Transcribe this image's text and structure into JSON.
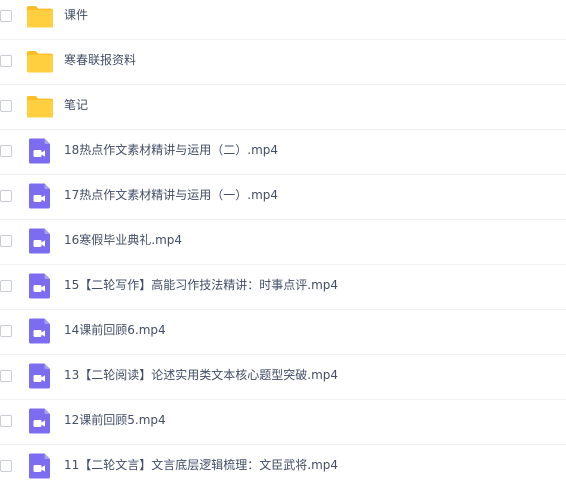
{
  "file_list": {
    "colors": {
      "folder": "#ffcf3f",
      "folder_tab": "#ffbe26",
      "video_icon": "#7c6cf0",
      "text": "#424e67",
      "divider": "#eef0f4"
    },
    "items": [
      {
        "type": "folder",
        "icon": "folder-icon",
        "name": "课件"
      },
      {
        "type": "folder",
        "icon": "folder-icon",
        "name": "寒春联报资料"
      },
      {
        "type": "folder",
        "icon": "folder-icon",
        "name": "笔记"
      },
      {
        "type": "video",
        "icon": "video-file-icon",
        "name": "18热点作文素材精讲与运用（二）.mp4"
      },
      {
        "type": "video",
        "icon": "video-file-icon",
        "name": "17热点作文素材精讲与运用（一）.mp4"
      },
      {
        "type": "video",
        "icon": "video-file-icon",
        "name": "16寒假毕业典礼.mp4"
      },
      {
        "type": "video",
        "icon": "video-file-icon",
        "name": "15【二轮写作】高能习作技法精讲：时事点评.mp4"
      },
      {
        "type": "video",
        "icon": "video-file-icon",
        "name": "14课前回顾6.mp4"
      },
      {
        "type": "video",
        "icon": "video-file-icon",
        "name": "13【二轮阅读】论述实用类文本核心题型突破.mp4"
      },
      {
        "type": "video",
        "icon": "video-file-icon",
        "name": "12课前回顾5.mp4"
      },
      {
        "type": "video",
        "icon": "video-file-icon",
        "name": "11【二轮文言】文言底层逻辑梳理：文臣武将.mp4"
      }
    ]
  }
}
